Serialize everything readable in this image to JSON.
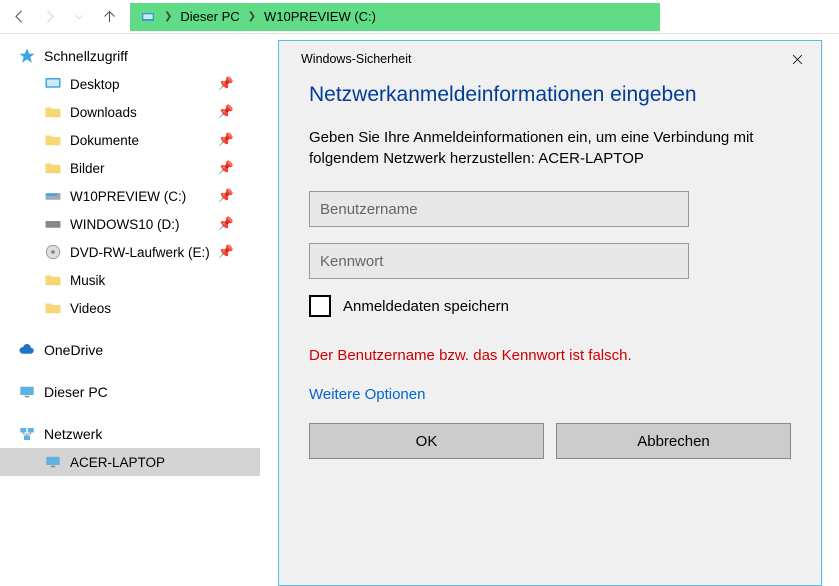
{
  "breadcrumb": {
    "segments": [
      "Dieser PC",
      "W10PREVIEW (C:)"
    ]
  },
  "tree": {
    "quick": {
      "label": "Schnellzugriff",
      "items": [
        {
          "label": "Desktop",
          "pinned": true
        },
        {
          "label": "Downloads",
          "pinned": true
        },
        {
          "label": "Dokumente",
          "pinned": true
        },
        {
          "label": "Bilder",
          "pinned": true
        },
        {
          "label": "W10PREVIEW (C:)",
          "pinned": true
        },
        {
          "label": "WINDOWS10 (D:)",
          "pinned": true
        },
        {
          "label": "DVD-RW-Laufwerk (E:)",
          "pinned": true
        },
        {
          "label": "Musik",
          "pinned": false
        },
        {
          "label": "Videos",
          "pinned": false
        }
      ]
    },
    "onedrive": "OneDrive",
    "thispc": "Dieser PC",
    "network": {
      "label": "Netzwerk",
      "items": [
        {
          "label": "ACER-LAPTOP"
        }
      ]
    }
  },
  "dialog": {
    "caption": "Windows-Sicherheit",
    "heading": "Netzwerkanmeldeinformationen eingeben",
    "body": "Geben Sie Ihre Anmeldeinformationen ein, um eine Verbindung mit folgendem Netzwerk herzustellen: ACER-LAPTOP",
    "user_ph": "Benutzername",
    "pass_ph": "Kennwort",
    "remember": "Anmeldedaten speichern",
    "error": "Der Benutzername bzw. das Kennwort ist falsch.",
    "more": "Weitere Optionen",
    "ok": "OK",
    "cancel": "Abbrechen"
  }
}
